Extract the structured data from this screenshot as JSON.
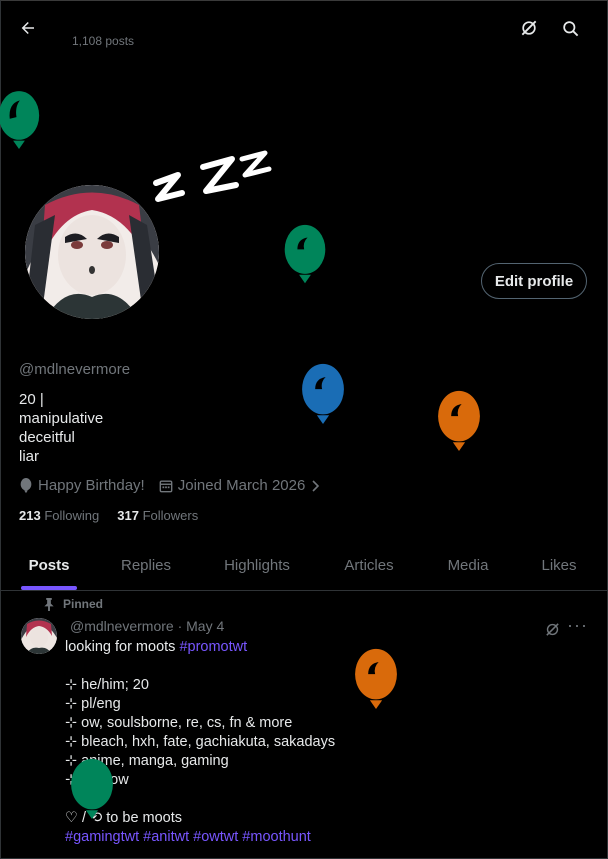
{
  "header": {
    "post_count": "1,108 posts"
  },
  "profile": {
    "handle": "@mdlnevermore",
    "bio_lines": [
      "20 |",
      "manipulative",
      "deceitful",
      "liar"
    ],
    "edit_label": "Edit profile",
    "birthday": "Happy Birthday!",
    "joined": "Joined March 2026",
    "following_count": "213",
    "following_label": "Following",
    "followers_count": "317",
    "followers_label": "Followers"
  },
  "tabs": [
    {
      "label": "Posts"
    },
    {
      "label": "Replies"
    },
    {
      "label": "Highlights"
    },
    {
      "label": "Articles"
    },
    {
      "label": "Media"
    },
    {
      "label": "Likes"
    }
  ],
  "post": {
    "pinned_label": "Pinned",
    "header": "@mdlnevermore · May 4",
    "line1_text": "looking for moots ",
    "line1_hash": "#promotwt",
    "lines": [
      "",
      "⊹ he/him; 20",
      "⊹ pl/eng",
      "⊹ ow, soulsborne, re, cs, fn & more",
      "⊹ bleach, hxh, fate, gachiakuta, sakadays",
      "⊹ anime, manga, gaming",
      "⊹ pisslow",
      ""
    ],
    "last_text": "♡ / ⟲ to be moots",
    "hashtags": "#gamingtwt #anitwt #owtwt #moothunt"
  },
  "colors": {
    "accent": "#7856ff",
    "balloon_green": "#00855a",
    "balloon_blue": "#1a6db5",
    "balloon_orange": "#d96a0b"
  }
}
